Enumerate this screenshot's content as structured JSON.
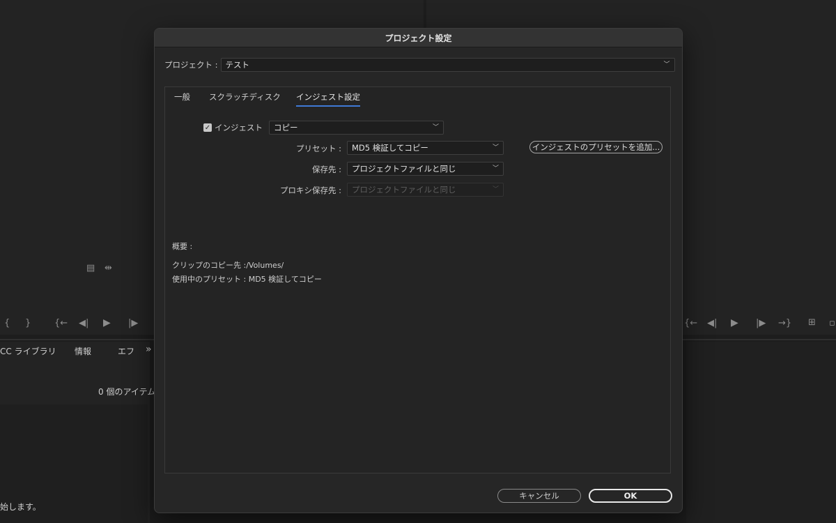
{
  "background": {
    "library_tab": "CC ライブラリ",
    "info_tab": "情報",
    "effects_tab": "エフ",
    "more_tabs": "»",
    "item_count": "0 個のアイテム",
    "bottom_text": "始します。"
  },
  "dialog": {
    "title": "プロジェクト設定",
    "project_label": "プロジェクト :",
    "project_value": "テスト",
    "tabs": [
      {
        "label": "一般"
      },
      {
        "label": "スクラッチディスク"
      },
      {
        "label": "インジェスト設定"
      }
    ],
    "ingest": {
      "checkbox_label": "インジェスト",
      "checked": true,
      "mode_value": "コピー",
      "preset_label": "プリセット :",
      "preset_value": "MD5 検証してコピー",
      "add_preset_button": "インジェストのプリセットを追加...",
      "destination_label": "保存先 :",
      "destination_value": "プロジェクトファイルと同じ",
      "proxy_label": "プロキシ保存先 :",
      "proxy_value": "プロジェクトファイルと同じ"
    },
    "summary": {
      "label": "概要 :",
      "copy_dest": "クリップのコピー先 :/Volumes/",
      "preset_in_use": "使用中のプリセット : MD5 検証してコピー"
    },
    "cancel_button": "キャンセル",
    "ok_button": "OK"
  },
  "colors": {
    "accent": "#3f7ad6",
    "dialog_bg": "#262626",
    "app_bg": "#1d1d1d"
  }
}
